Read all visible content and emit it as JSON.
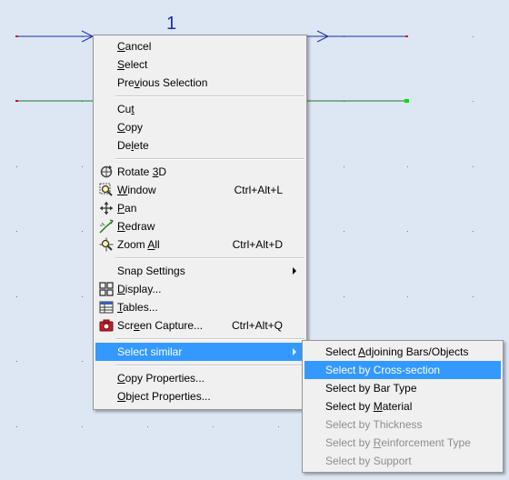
{
  "canvas": {
    "node_label": "1",
    "colors": {
      "background": "#dde7f4",
      "bar_blue": "#1b2fa8",
      "bar_green": "#1a7a2a",
      "node_end": "#d0003a",
      "label": "#1b2fa8",
      "highlight": "#3399ff"
    }
  },
  "context_menu": {
    "items": [
      {
        "pre": "",
        "key": "C",
        "post": "ancel"
      },
      {
        "pre": "",
        "key": "S",
        "post": "elect"
      },
      {
        "pre": "Pre",
        "key": "v",
        "post": "ious Selection"
      },
      {
        "pre": "Cu",
        "key": "t",
        "post": ""
      },
      {
        "pre": "",
        "key": "C",
        "post": "opy"
      },
      {
        "pre": "De",
        "key": "l",
        "post": "ete"
      },
      {
        "pre": "Rotate ",
        "key": "3",
        "post": "D",
        "icon": "rotate-3d-icon"
      },
      {
        "pre": "",
        "key": "W",
        "post": "indow",
        "icon": "zoom-window-icon",
        "shortcut": "Ctrl+Alt+L"
      },
      {
        "pre": "",
        "key": "P",
        "post": "an",
        "icon": "pan-icon"
      },
      {
        "pre": "",
        "key": "R",
        "post": "edraw",
        "icon": "redraw-icon"
      },
      {
        "pre": "Zoom ",
        "key": "A",
        "post": "ll",
        "icon": "zoom-all-icon",
        "shortcut": "Ctrl+Alt+D"
      },
      {
        "label": "Snap Settings",
        "submenu": true
      },
      {
        "pre": "",
        "key": "D",
        "post": "isplay...",
        "icon": "display-icon"
      },
      {
        "pre": "",
        "key": "T",
        "post": "ables...",
        "icon": "tables-icon"
      },
      {
        "pre": "Scr",
        "key": "e",
        "post": "en Capture...",
        "icon": "screen-capture-icon",
        "shortcut": "Ctrl+Alt+Q"
      },
      {
        "label": "Select similar",
        "submenu": true,
        "highlighted": true
      },
      {
        "pre": "",
        "key": "C",
        "post": "opy Properties..."
      },
      {
        "pre": "",
        "key": "O",
        "post": "bject Properties..."
      }
    ]
  },
  "submenu": {
    "items": [
      {
        "pre": "Select ",
        "key": "A",
        "post": "djoining Bars/Objects"
      },
      {
        "pre": "Select by Cross-section",
        "key": "",
        "post": "",
        "highlighted": true
      },
      {
        "pre": "Select by Bar Type",
        "key": "",
        "post": ""
      },
      {
        "pre": "Select by ",
        "key": "M",
        "post": "aterial"
      },
      {
        "pre": "Select by Thickness",
        "key": "",
        "post": "",
        "disabled": true
      },
      {
        "pre": "Select by ",
        "key": "R",
        "post": "einforcement Type",
        "disabled": true
      },
      {
        "pre": "Select by Support",
        "key": "",
        "post": "",
        "disabled": true
      }
    ]
  }
}
